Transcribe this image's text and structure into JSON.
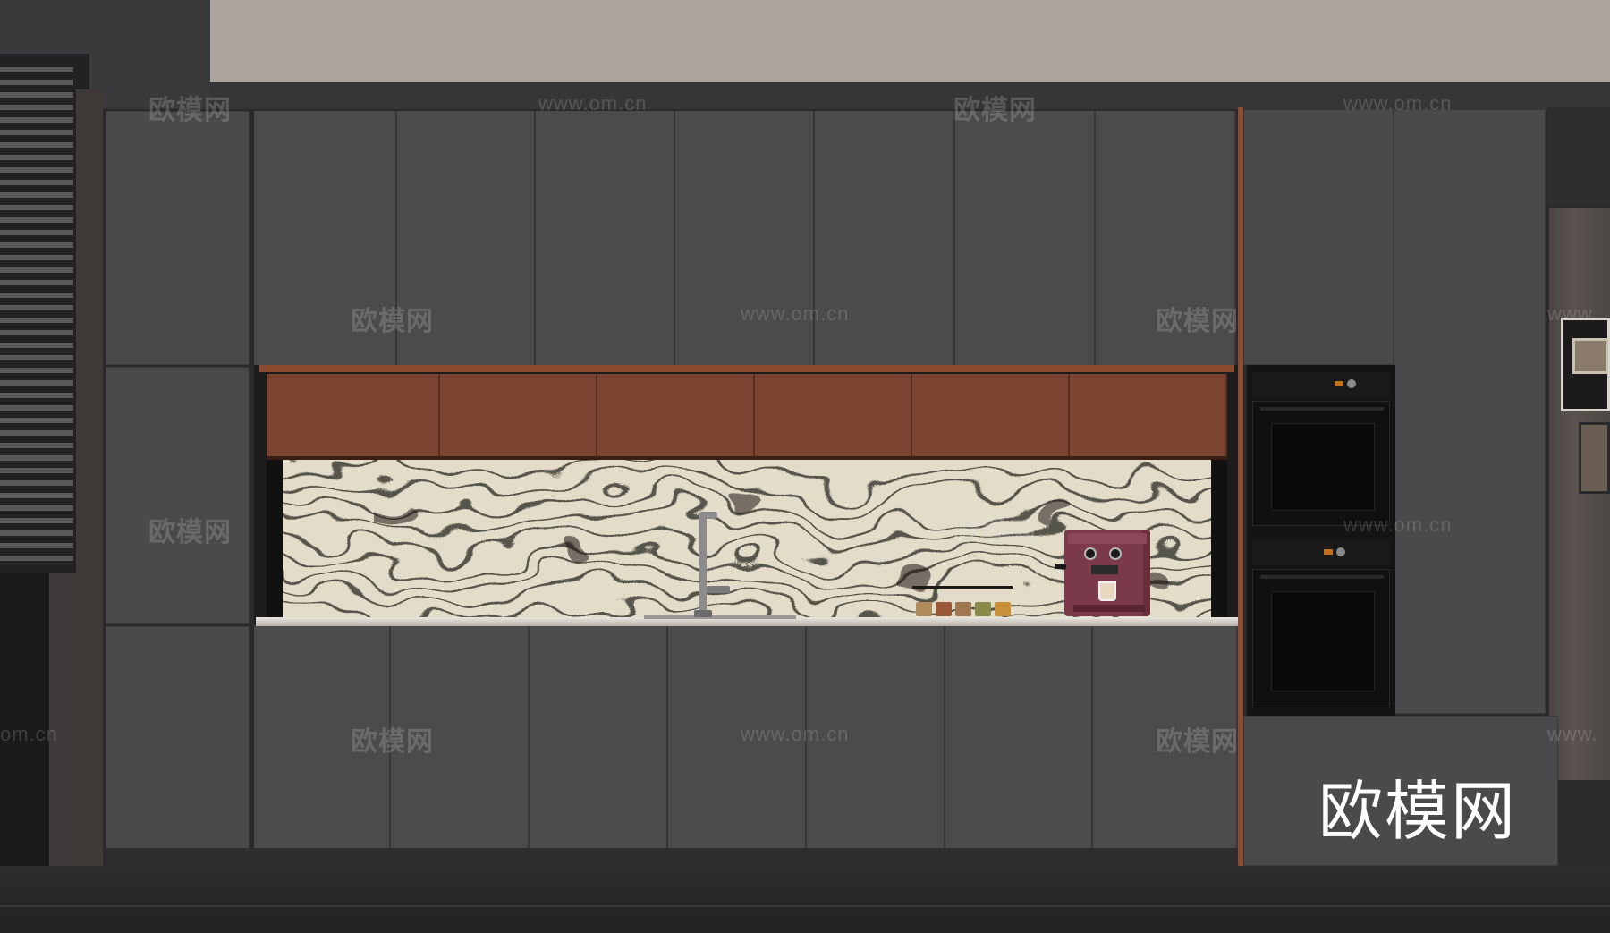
{
  "watermarks": {
    "brand_cn": "欧模网",
    "url": "www.om.cn",
    "url_partial_left": "om.cn",
    "url_partial_right": "www.",
    "logo": "欧模网"
  },
  "colors": {
    "ceiling": "#aca59f",
    "cabinet": "#4b4b4d",
    "cabinet_dark": "#38383a",
    "accent_wood": "#7a4430",
    "trim_copper": "#8a4a30",
    "backsplash_base": "#e2dcc8",
    "backsplash_veins": "#2a2622",
    "oven": "#161616",
    "coffee_machine": "#7a3a4a",
    "floor": "#2a2a2c"
  },
  "objects": {
    "window_blinds": "window-blinds",
    "faucet": "faucet",
    "spice_jars": "spice-jars",
    "coffee_machine": "coffee-machine",
    "built_in_ovens": "built-in-ovens",
    "wall_art": "wall-art"
  }
}
